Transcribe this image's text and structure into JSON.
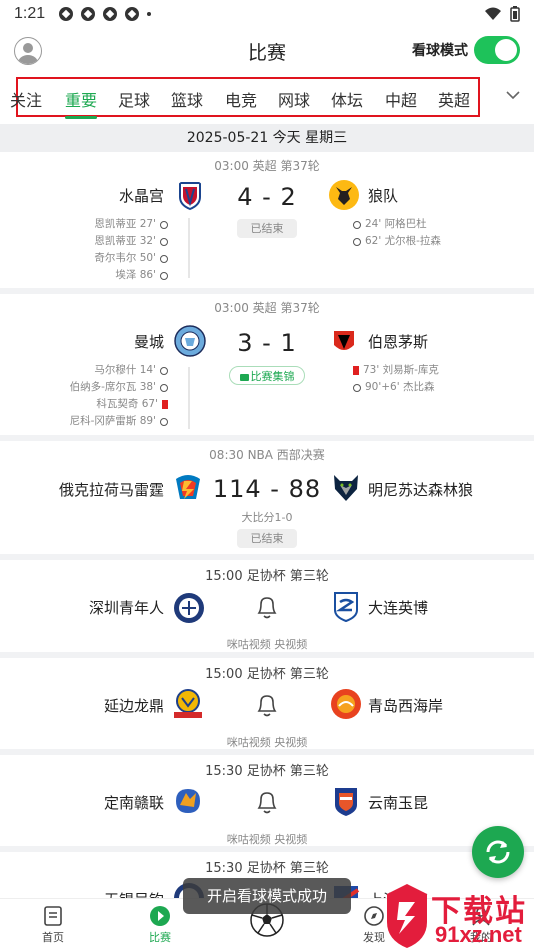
{
  "status_bar": {
    "time": "1:21"
  },
  "header": {
    "title": "比赛",
    "watch_mode_label": "看球模式",
    "watch_mode_on": true
  },
  "tabs": [
    {
      "label": "关注"
    },
    {
      "label": "重要"
    },
    {
      "label": "足球"
    },
    {
      "label": "篮球"
    },
    {
      "label": "电竞"
    },
    {
      "label": "网球"
    },
    {
      "label": "体坛"
    },
    {
      "label": "中超"
    },
    {
      "label": "英超"
    }
  ],
  "active_tab": "重要",
  "date_bar": "2025-05-21 今天 星期三",
  "matches": [
    {
      "meta": "03:00 英超 第37轮",
      "home": "水晶宫",
      "away": "狼队",
      "score": "4 - 2",
      "status": "已结束",
      "home_events": [
        "恩凯蒂亚 27'",
        "恩凯蒂亚 32'",
        "奇尔韦尔 50'",
        "埃泽 86'"
      ],
      "away_events": [
        "24' 阿格巴杜",
        "62' 尤尔根-拉森"
      ]
    },
    {
      "meta": "03:00 英超 第37轮",
      "home": "曼城",
      "away": "伯恩茅斯",
      "score": "3 - 1",
      "status": "比赛集锦",
      "home_events": [
        "马尔穆什 14'",
        "伯纳多-席尔瓦 38'",
        "科瓦契奇 67'",
        "尼科-冈萨雷斯 89'"
      ],
      "away_events": [
        "73' 刘易斯-库克",
        "90'+6' 杰比森"
      ]
    },
    {
      "meta": "08:30 NBA 西部决赛",
      "home": "俄克拉荷马雷霆",
      "away": "明尼苏达森林狼",
      "score": "114 - 88",
      "sub": "大比分1-0",
      "status": "已结束"
    },
    {
      "meta": "15:00 足协杯 第三轮",
      "home": "深圳青年人",
      "away": "大连英博",
      "broadcast": "咪咕视频 央视频"
    },
    {
      "meta": "15:00 足协杯 第三轮",
      "home": "延边龙鼎",
      "away": "青岛西海岸",
      "broadcast": "咪咕视频 央视频"
    },
    {
      "meta": "15:30 足协杯 第三轮",
      "home": "定南赣联",
      "away": "云南玉昆",
      "broadcast": "咪咕视频 央视频"
    },
    {
      "meta": "15:30 足协杯 第三轮",
      "home": "无锡吴钩",
      "away": "上海申花"
    }
  ],
  "toast": "开启看球模式成功",
  "bottom_nav": [
    {
      "label": "首页",
      "icon": "document-icon"
    },
    {
      "label": "比赛",
      "icon": "play-icon"
    },
    {
      "label": "发现",
      "icon": "compass-icon"
    },
    {
      "label": "我的",
      "icon": "user-icon"
    }
  ],
  "watermark": {
    "text": "下载站",
    "url": "91xz.net"
  },
  "colors": {
    "accent": "#1da851",
    "highlight_box": "#e0141e",
    "watermark": "#e31d3c"
  }
}
